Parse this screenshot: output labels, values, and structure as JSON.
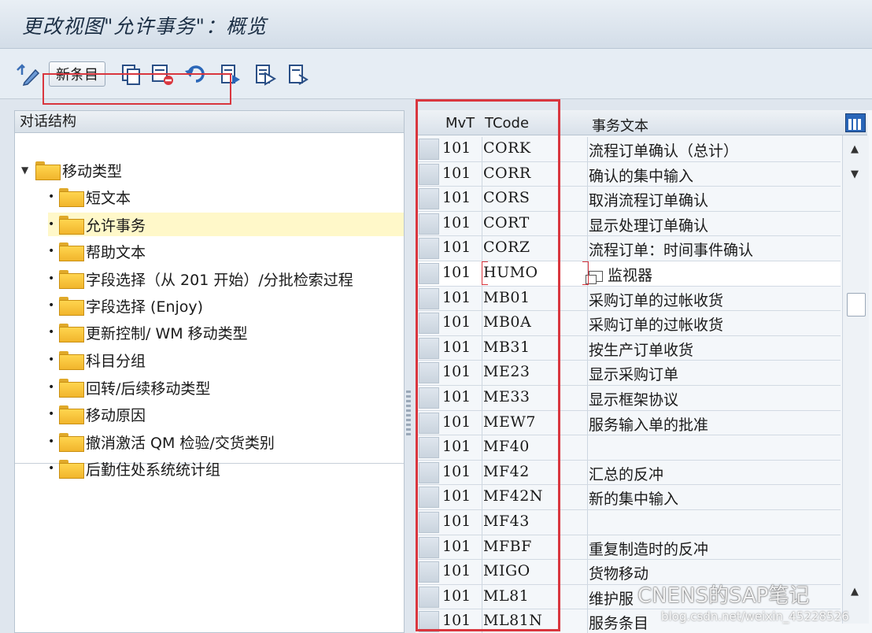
{
  "window": {
    "title": "更改视图\"允许事务\"：概览"
  },
  "toolbar": {
    "new_entries_label": "新条目"
  },
  "tree": {
    "header": "对话结构",
    "root": "移动类型",
    "items": [
      "短文本",
      "允许事务",
      "帮助文本",
      "字段选择（从 201 开始）/分批检索过程",
      "字段选择 (Enjoy)",
      "更新控制/ WM 移动类型",
      "科目分组",
      "回转/后续移动类型",
      "移动原因",
      "撤消激活 QM 检验/交货类别",
      "后勤住处系统统计组"
    ],
    "selected_index": 1
  },
  "table": {
    "headers": {
      "mvt": "MvT",
      "tcode": "TCode",
      "text": "事务文本"
    },
    "rows": [
      {
        "mvt": "101",
        "tcode": "CORK",
        "text": "流程订单确认（总计）"
      },
      {
        "mvt": "101",
        "tcode": "CORR",
        "text": "确认的集中输入"
      },
      {
        "mvt": "101",
        "tcode": "CORS",
        "text": "取消流程订单确认"
      },
      {
        "mvt": "101",
        "tcode": "CORT",
        "text": "显示处理订单确认"
      },
      {
        "mvt": "101",
        "tcode": "CORZ",
        "text": "流程订单：时间事件确认"
      },
      {
        "mvt": "101",
        "tcode": "HUMO",
        "text": "监视器"
      },
      {
        "mvt": "101",
        "tcode": "MB01",
        "text": "采购订单的过帐收货"
      },
      {
        "mvt": "101",
        "tcode": "MB0A",
        "text": "采购订单的过帐收货"
      },
      {
        "mvt": "101",
        "tcode": "MB31",
        "text": "按生产订单收货"
      },
      {
        "mvt": "101",
        "tcode": "ME23",
        "text": "显示采购订单"
      },
      {
        "mvt": "101",
        "tcode": "ME33",
        "text": "显示框架协议"
      },
      {
        "mvt": "101",
        "tcode": "MEW7",
        "text": "服务输入单的批准"
      },
      {
        "mvt": "101",
        "tcode": "MF40",
        "text": ""
      },
      {
        "mvt": "101",
        "tcode": "MF42",
        "text": "汇总的反冲"
      },
      {
        "mvt": "101",
        "tcode": "MF42N",
        "text": "新的集中输入"
      },
      {
        "mvt": "101",
        "tcode": "MF43",
        "text": ""
      },
      {
        "mvt": "101",
        "tcode": "MFBF",
        "text": "重复制造时的反冲"
      },
      {
        "mvt": "101",
        "tcode": "MIGO",
        "text": "货物移动"
      },
      {
        "mvt": "101",
        "tcode": "ML81",
        "text": "维护服"
      },
      {
        "mvt": "101",
        "tcode": "ML81N",
        "text": "服务条目"
      }
    ]
  },
  "watermark": {
    "line1": "CNENS的SAP笔记",
    "line2": "blog.csdn.net/weixin_45228526"
  }
}
